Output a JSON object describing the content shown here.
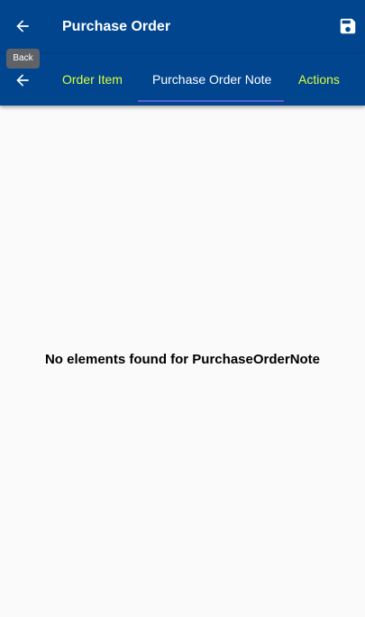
{
  "colors": {
    "app_bar": "#01458f",
    "inactive_tab": "#d8ff3c",
    "active_tab": "#ffffff",
    "tab_indicator": "#5b5bd6",
    "tooltip_bg": "#5f6368",
    "page_bg": "#fafafa"
  },
  "app_bar": {
    "title": "Purchase Order",
    "back_icon": "arrow-left-icon",
    "save_icon": "floppy-disk-icon"
  },
  "tooltip": {
    "text": "Back"
  },
  "tab_bar": {
    "back_icon": "arrow-left-icon",
    "tabs": [
      {
        "label": "Order Item",
        "active": false
      },
      {
        "label": "Purchase Order Note",
        "active": true
      },
      {
        "label": "Actions",
        "active": false
      }
    ]
  },
  "main": {
    "empty_message": "No elements found for PurchaseOrderNote"
  }
}
